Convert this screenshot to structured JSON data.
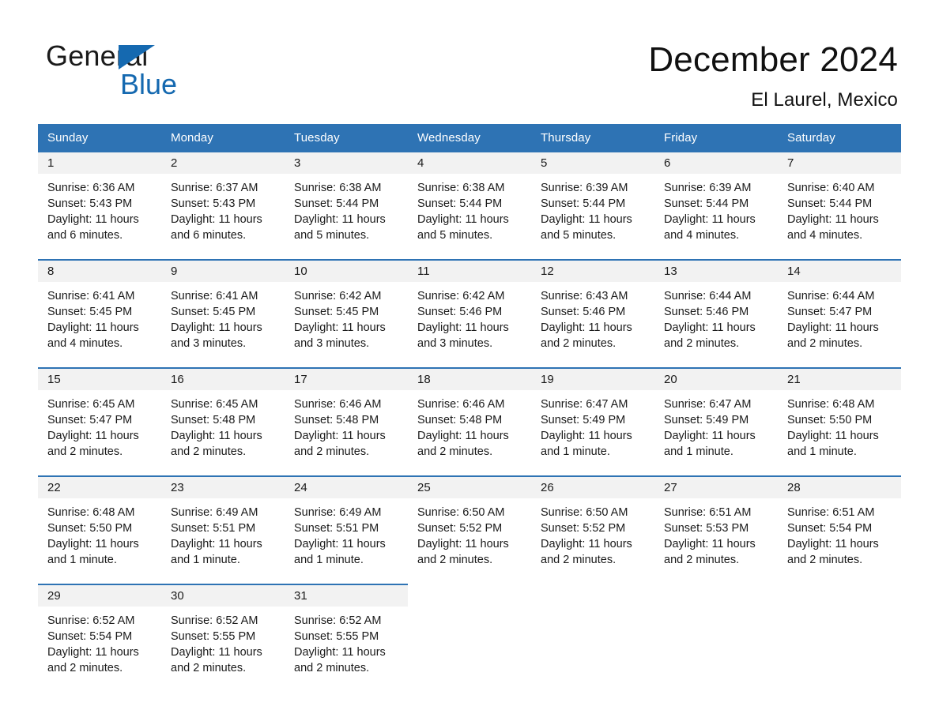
{
  "brand": {
    "name_part1": "General",
    "name_part2": "Blue",
    "triangle_icon": "triangle-icon",
    "accent_color": "#1569b0"
  },
  "header": {
    "title": "December 2024",
    "subtitle": "El Laurel, Mexico"
  },
  "calendar": {
    "header_bg": "#2e73b4",
    "daynum_bg": "#f2f2f2",
    "weekday_headers": [
      "Sunday",
      "Monday",
      "Tuesday",
      "Wednesday",
      "Thursday",
      "Friday",
      "Saturday"
    ],
    "weeks": [
      [
        {
          "day": "1",
          "sunrise": "Sunrise: 6:36 AM",
          "sunset": "Sunset: 5:43 PM",
          "daylight_1": "Daylight: 11 hours",
          "daylight_2": "and 6 minutes."
        },
        {
          "day": "2",
          "sunrise": "Sunrise: 6:37 AM",
          "sunset": "Sunset: 5:43 PM",
          "daylight_1": "Daylight: 11 hours",
          "daylight_2": "and 6 minutes."
        },
        {
          "day": "3",
          "sunrise": "Sunrise: 6:38 AM",
          "sunset": "Sunset: 5:44 PM",
          "daylight_1": "Daylight: 11 hours",
          "daylight_2": "and 5 minutes."
        },
        {
          "day": "4",
          "sunrise": "Sunrise: 6:38 AM",
          "sunset": "Sunset: 5:44 PM",
          "daylight_1": "Daylight: 11 hours",
          "daylight_2": "and 5 minutes."
        },
        {
          "day": "5",
          "sunrise": "Sunrise: 6:39 AM",
          "sunset": "Sunset: 5:44 PM",
          "daylight_1": "Daylight: 11 hours",
          "daylight_2": "and 5 minutes."
        },
        {
          "day": "6",
          "sunrise": "Sunrise: 6:39 AM",
          "sunset": "Sunset: 5:44 PM",
          "daylight_1": "Daylight: 11 hours",
          "daylight_2": "and 4 minutes."
        },
        {
          "day": "7",
          "sunrise": "Sunrise: 6:40 AM",
          "sunset": "Sunset: 5:44 PM",
          "daylight_1": "Daylight: 11 hours",
          "daylight_2": "and 4 minutes."
        }
      ],
      [
        {
          "day": "8",
          "sunrise": "Sunrise: 6:41 AM",
          "sunset": "Sunset: 5:45 PM",
          "daylight_1": "Daylight: 11 hours",
          "daylight_2": "and 4 minutes."
        },
        {
          "day": "9",
          "sunrise": "Sunrise: 6:41 AM",
          "sunset": "Sunset: 5:45 PM",
          "daylight_1": "Daylight: 11 hours",
          "daylight_2": "and 3 minutes."
        },
        {
          "day": "10",
          "sunrise": "Sunrise: 6:42 AM",
          "sunset": "Sunset: 5:45 PM",
          "daylight_1": "Daylight: 11 hours",
          "daylight_2": "and 3 minutes."
        },
        {
          "day": "11",
          "sunrise": "Sunrise: 6:42 AM",
          "sunset": "Sunset: 5:46 PM",
          "daylight_1": "Daylight: 11 hours",
          "daylight_2": "and 3 minutes."
        },
        {
          "day": "12",
          "sunrise": "Sunrise: 6:43 AM",
          "sunset": "Sunset: 5:46 PM",
          "daylight_1": "Daylight: 11 hours",
          "daylight_2": "and 2 minutes."
        },
        {
          "day": "13",
          "sunrise": "Sunrise: 6:44 AM",
          "sunset": "Sunset: 5:46 PM",
          "daylight_1": "Daylight: 11 hours",
          "daylight_2": "and 2 minutes."
        },
        {
          "day": "14",
          "sunrise": "Sunrise: 6:44 AM",
          "sunset": "Sunset: 5:47 PM",
          "daylight_1": "Daylight: 11 hours",
          "daylight_2": "and 2 minutes."
        }
      ],
      [
        {
          "day": "15",
          "sunrise": "Sunrise: 6:45 AM",
          "sunset": "Sunset: 5:47 PM",
          "daylight_1": "Daylight: 11 hours",
          "daylight_2": "and 2 minutes."
        },
        {
          "day": "16",
          "sunrise": "Sunrise: 6:45 AM",
          "sunset": "Sunset: 5:48 PM",
          "daylight_1": "Daylight: 11 hours",
          "daylight_2": "and 2 minutes."
        },
        {
          "day": "17",
          "sunrise": "Sunrise: 6:46 AM",
          "sunset": "Sunset: 5:48 PM",
          "daylight_1": "Daylight: 11 hours",
          "daylight_2": "and 2 minutes."
        },
        {
          "day": "18",
          "sunrise": "Sunrise: 6:46 AM",
          "sunset": "Sunset: 5:48 PM",
          "daylight_1": "Daylight: 11 hours",
          "daylight_2": "and 2 minutes."
        },
        {
          "day": "19",
          "sunrise": "Sunrise: 6:47 AM",
          "sunset": "Sunset: 5:49 PM",
          "daylight_1": "Daylight: 11 hours",
          "daylight_2": "and 1 minute."
        },
        {
          "day": "20",
          "sunrise": "Sunrise: 6:47 AM",
          "sunset": "Sunset: 5:49 PM",
          "daylight_1": "Daylight: 11 hours",
          "daylight_2": "and 1 minute."
        },
        {
          "day": "21",
          "sunrise": "Sunrise: 6:48 AM",
          "sunset": "Sunset: 5:50 PM",
          "daylight_1": "Daylight: 11 hours",
          "daylight_2": "and 1 minute."
        }
      ],
      [
        {
          "day": "22",
          "sunrise": "Sunrise: 6:48 AM",
          "sunset": "Sunset: 5:50 PM",
          "daylight_1": "Daylight: 11 hours",
          "daylight_2": "and 1 minute."
        },
        {
          "day": "23",
          "sunrise": "Sunrise: 6:49 AM",
          "sunset": "Sunset: 5:51 PM",
          "daylight_1": "Daylight: 11 hours",
          "daylight_2": "and 1 minute."
        },
        {
          "day": "24",
          "sunrise": "Sunrise: 6:49 AM",
          "sunset": "Sunset: 5:51 PM",
          "daylight_1": "Daylight: 11 hours",
          "daylight_2": "and 1 minute."
        },
        {
          "day": "25",
          "sunrise": "Sunrise: 6:50 AM",
          "sunset": "Sunset: 5:52 PM",
          "daylight_1": "Daylight: 11 hours",
          "daylight_2": "and 2 minutes."
        },
        {
          "day": "26",
          "sunrise": "Sunrise: 6:50 AM",
          "sunset": "Sunset: 5:52 PM",
          "daylight_1": "Daylight: 11 hours",
          "daylight_2": "and 2 minutes."
        },
        {
          "day": "27",
          "sunrise": "Sunrise: 6:51 AM",
          "sunset": "Sunset: 5:53 PM",
          "daylight_1": "Daylight: 11 hours",
          "daylight_2": "and 2 minutes."
        },
        {
          "day": "28",
          "sunrise": "Sunrise: 6:51 AM",
          "sunset": "Sunset: 5:54 PM",
          "daylight_1": "Daylight: 11 hours",
          "daylight_2": "and 2 minutes."
        }
      ],
      [
        {
          "day": "29",
          "sunrise": "Sunrise: 6:52 AM",
          "sunset": "Sunset: 5:54 PM",
          "daylight_1": "Daylight: 11 hours",
          "daylight_2": "and 2 minutes."
        },
        {
          "day": "30",
          "sunrise": "Sunrise: 6:52 AM",
          "sunset": "Sunset: 5:55 PM",
          "daylight_1": "Daylight: 11 hours",
          "daylight_2": "and 2 minutes."
        },
        {
          "day": "31",
          "sunrise": "Sunrise: 6:52 AM",
          "sunset": "Sunset: 5:55 PM",
          "daylight_1": "Daylight: 11 hours",
          "daylight_2": "and 2 minutes."
        },
        {
          "day": "",
          "sunrise": "",
          "sunset": "",
          "daylight_1": "",
          "daylight_2": ""
        },
        {
          "day": "",
          "sunrise": "",
          "sunset": "",
          "daylight_1": "",
          "daylight_2": ""
        },
        {
          "day": "",
          "sunrise": "",
          "sunset": "",
          "daylight_1": "",
          "daylight_2": ""
        },
        {
          "day": "",
          "sunrise": "",
          "sunset": "",
          "daylight_1": "",
          "daylight_2": ""
        }
      ]
    ]
  }
}
